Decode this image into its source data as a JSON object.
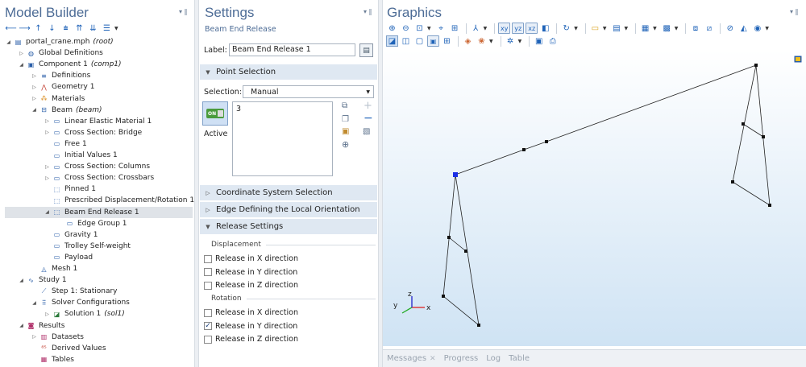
{
  "model_builder": {
    "title": "Model Builder",
    "tree": [
      {
        "label": "portal_crane.mph",
        "ital": "(root)",
        "depth": 0,
        "tog": "◢",
        "icon": "file-icon"
      },
      {
        "label": "Global Definitions",
        "ital": "",
        "depth": 1,
        "tog": "▷",
        "icon": "globe-icon"
      },
      {
        "label": "Component 1",
        "ital": "(comp1)",
        "depth": 1,
        "tog": "◢",
        "icon": "component-icon"
      },
      {
        "label": "Definitions",
        "ital": "",
        "depth": 2,
        "tog": "▷",
        "icon": "definitions-icon"
      },
      {
        "label": "Geometry 1",
        "ital": "",
        "depth": 2,
        "tog": "▷",
        "icon": "geometry-icon"
      },
      {
        "label": "Materials",
        "ital": "",
        "depth": 2,
        "tog": "▷",
        "icon": "materials-icon"
      },
      {
        "label": "Beam",
        "ital": "(beam)",
        "depth": 2,
        "tog": "◢",
        "icon": "beam-icon"
      },
      {
        "label": "Linear Elastic Material 1",
        "ital": "",
        "depth": 3,
        "tog": "▷",
        "icon": "node-icon"
      },
      {
        "label": "Cross Section: Bridge",
        "ital": "",
        "depth": 3,
        "tog": "▷",
        "icon": "node-icon"
      },
      {
        "label": "Free 1",
        "ital": "",
        "depth": 3,
        "tog": "",
        "icon": "node-icon"
      },
      {
        "label": "Initial Values 1",
        "ital": "",
        "depth": 3,
        "tog": "",
        "icon": "node-icon"
      },
      {
        "label": "Cross Section: Columns",
        "ital": "",
        "depth": 3,
        "tog": "▷",
        "icon": "node-icon"
      },
      {
        "label": "Cross Section: Crossbars",
        "ital": "",
        "depth": 3,
        "tog": "▷",
        "icon": "node-icon"
      },
      {
        "label": "Pinned 1",
        "ital": "",
        "depth": 3,
        "tog": "",
        "icon": "dashed-node-icon"
      },
      {
        "label": "Prescribed Displacement/Rotation 1",
        "ital": "",
        "depth": 3,
        "tog": "",
        "icon": "dashed-node-icon"
      },
      {
        "label": "Beam End Release 1",
        "ital": "",
        "depth": 3,
        "tog": "◢",
        "icon": "dashed-node-icon",
        "selected": true
      },
      {
        "label": "Edge Group 1",
        "ital": "",
        "depth": 4,
        "tog": "",
        "icon": "node-icon"
      },
      {
        "label": "Gravity 1",
        "ital": "",
        "depth": 3,
        "tog": "",
        "icon": "node-icon"
      },
      {
        "label": "Trolley Self-weight",
        "ital": "",
        "depth": 3,
        "tog": "",
        "icon": "node-icon"
      },
      {
        "label": "Payload",
        "ital": "",
        "depth": 3,
        "tog": "",
        "icon": "node-icon"
      },
      {
        "label": "Mesh 1",
        "ital": "",
        "depth": 2,
        "tog": "",
        "icon": "mesh-icon"
      },
      {
        "label": "Study 1",
        "ital": "",
        "depth": 1,
        "tog": "◢",
        "icon": "study-icon"
      },
      {
        "label": "Step 1: Stationary",
        "ital": "",
        "depth": 2,
        "tog": "",
        "icon": "step-icon"
      },
      {
        "label": "Solver Configurations",
        "ital": "",
        "depth": 2,
        "tog": "◢",
        "icon": "solver-icon"
      },
      {
        "label": "Solution 1",
        "ital": "(sol1)",
        "depth": 3,
        "tog": "▷",
        "icon": "solution-icon"
      },
      {
        "label": "Results",
        "ital": "",
        "depth": 1,
        "tog": "◢",
        "icon": "results-icon"
      },
      {
        "label": "Datasets",
        "ital": "",
        "depth": 2,
        "tog": "▷",
        "icon": "datasets-icon"
      },
      {
        "label": "Derived Values",
        "ital": "",
        "depth": 2,
        "tog": "",
        "icon": "derived-values-icon"
      },
      {
        "label": "Tables",
        "ital": "",
        "depth": 2,
        "tog": "",
        "icon": "tables-icon"
      }
    ]
  },
  "settings": {
    "title": "Settings",
    "subtitle": "Beam End Release",
    "label_caption": "Label:",
    "label_value": "Beam End Release 1",
    "sections": {
      "point_selection": "Point Selection",
      "coordinate_system": "Coordinate System Selection",
      "edge_orientation": "Edge Defining the Local Orientation",
      "release_settings": "Release Settings"
    },
    "selection_caption": "Selection:",
    "selection_value": "Manual",
    "selection_list": [
      "3"
    ],
    "active_toggle_label": "ON",
    "active_label": "Active",
    "displacement_group": "Displacement",
    "rotation_group": "Rotation",
    "displacement": [
      {
        "label": "Release in X direction",
        "checked": false
      },
      {
        "label": "Release in Y direction",
        "checked": false
      },
      {
        "label": "Release in Z direction",
        "checked": false
      }
    ],
    "rotation": [
      {
        "label": "Release in X direction",
        "checked": false
      },
      {
        "label": "Release in Y direction",
        "checked": true
      },
      {
        "label": "Release in Z direction",
        "checked": false
      }
    ]
  },
  "graphics": {
    "title": "Graphics",
    "axes": {
      "x": "x",
      "y": "y",
      "z": "z"
    },
    "bottom_tabs": [
      "Messages",
      "Progress",
      "Log",
      "Table"
    ]
  },
  "colors": {
    "title": "#4d6c96",
    "section_bg": "#dfe8f2",
    "selected_point": "#1b2fe6",
    "canvas_top": "#ffffff",
    "canvas_bottom": "#cfe3f4"
  }
}
